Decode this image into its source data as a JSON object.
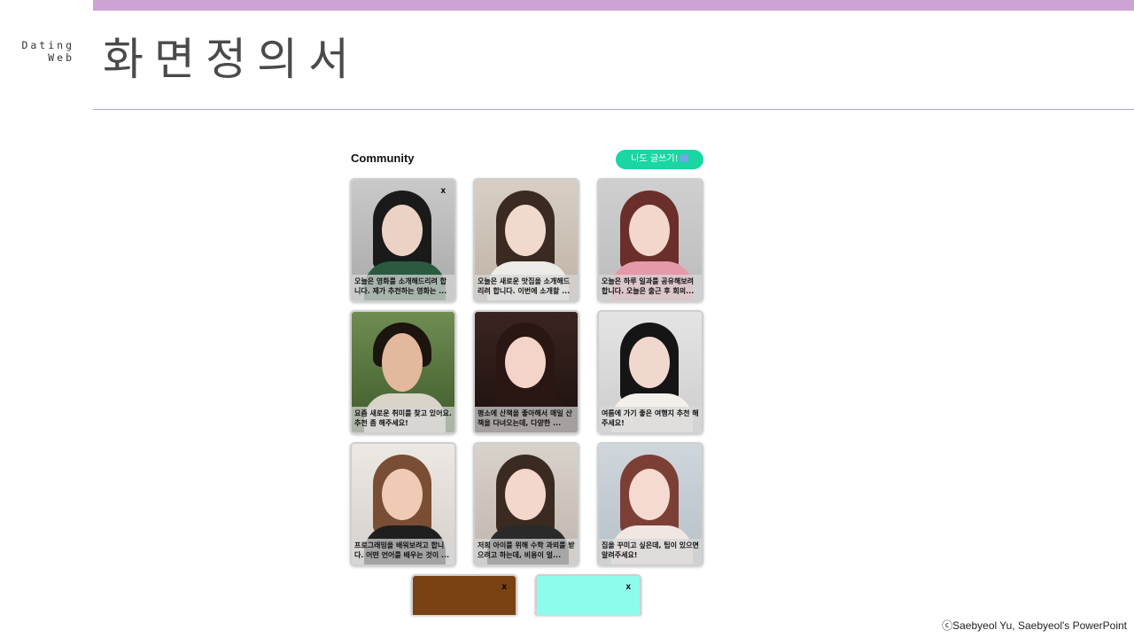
{
  "side_label": {
    "line1": "Dating",
    "line2": "Web"
  },
  "page_title": "화면정의서",
  "community": {
    "title": "Community",
    "write_button": "나도 글쓰기!"
  },
  "cards": [
    {
      "caption": "오늘은 영화를 소개해드리려 합니다. 제가 추천하는 영화는 ...",
      "close": "x"
    },
    {
      "caption": "오늘은 새로운 맛집을 소개해드리려 합니다. 이번에 소개할 ...",
      "close": ""
    },
    {
      "caption": "오늘은 하루 일과를 공유해보려 합니다. 오늘은 출근 후 회의...",
      "close": ""
    },
    {
      "caption": "요즘 새로운 취미를 찾고 있어요. 추천 좀 해주세요!",
      "close": ""
    },
    {
      "caption": "평소에 산책을 좋아해서 매일 산책을 다녀오는데, 다양한 ...",
      "close": ""
    },
    {
      "caption": "여름에 가기 좋은 여행지 추천 해주세요!",
      "close": ""
    },
    {
      "caption": "프로그래밍을 배워보려고 합니다. 어떤 언어를 배우는 것이 ...",
      "close": ""
    },
    {
      "caption": "저희 아이를 위해 수학 과외를 받으려고 하는데, 비용이 얼...",
      "close": ""
    },
    {
      "caption": "집을 꾸미고 싶은데, 팁이 있으면 알려주세요!",
      "close": ""
    },
    {
      "caption": "",
      "close": "x"
    },
    {
      "caption": "",
      "close": "x"
    }
  ],
  "copyright": "ⓒSaebyeol Yu, Saebyeol's PowerPoint"
}
